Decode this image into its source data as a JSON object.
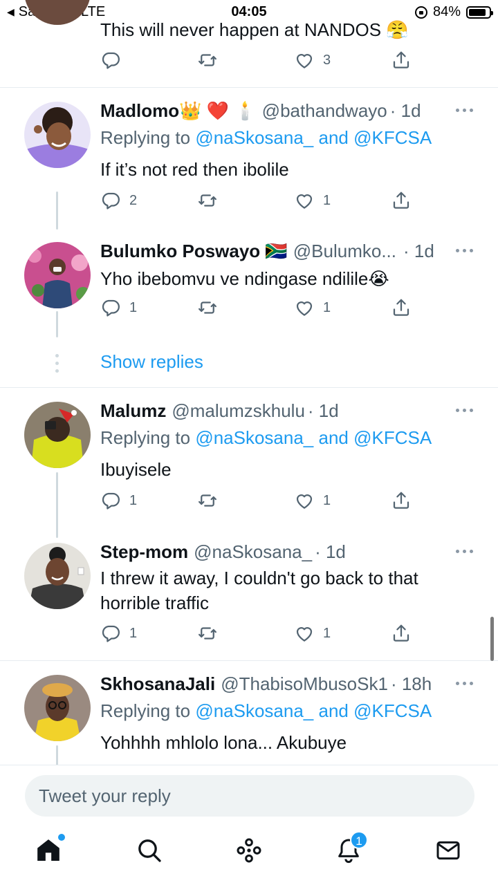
{
  "status_bar": {
    "back_app": "Safari",
    "network": "LTE",
    "time": "04:05",
    "battery": "84%",
    "battery_level": 0.84
  },
  "tweets": [
    {
      "body": "This will never happen at NANDOS 😤",
      "actions": {
        "replies": "",
        "retweets": "",
        "likes": "3"
      }
    },
    {
      "name": "Madlomo👑 ❤️ 🕯️",
      "handle": "@bathandwayo",
      "time": "· 1d",
      "replying_prefix": "Replying to",
      "replying_to": "@naSkosana_ and @KFCSA",
      "body": "If it’s not red then ibolile",
      "actions": {
        "replies": "2",
        "retweets": "",
        "likes": "1"
      }
    },
    {
      "name": "Bulumko Poswayo 🇿🇦",
      "handle": "@Bulumko...",
      "time": "· 1d",
      "body": "Yho ibebomvu ve ndingase ndilile😭",
      "actions": {
        "replies": "1",
        "retweets": "",
        "likes": "1"
      }
    },
    {
      "name": "Malumz",
      "handle": "@malumzskhulu",
      "time": "· 1d",
      "replying_prefix": "Replying to",
      "replying_to": "@naSkosana_ and @KFCSA",
      "body": "Ibuyisele",
      "actions": {
        "replies": "1",
        "retweets": "",
        "likes": "1"
      }
    },
    {
      "name": "Step-mom",
      "handle": "@naSkosana_",
      "time": "· 1d",
      "body": "I threw it away, I couldn't go back to that horrible traffic",
      "actions": {
        "replies": "1",
        "retweets": "",
        "likes": "1"
      }
    },
    {
      "name": "SkhosanaJali",
      "handle": "@ThabisoMbusoSk1",
      "time": "· 18h",
      "replying_prefix": "Replying to",
      "replying_to": "@naSkosana_ and @KFCSA",
      "body": "Yohhhh mhlolo lona... Akubuye"
    }
  ],
  "show_replies": "Show replies",
  "composer": {
    "placeholder": "Tweet your reply"
  },
  "tabbar": {
    "tabs": [
      "home",
      "search",
      "spaces",
      "notifications",
      "messages"
    ],
    "notifications_count": "1"
  },
  "colors": {
    "accent": "#1d9bf0",
    "text": "#0f1419",
    "secondary": "#536471",
    "divider": "#e6ecf0"
  },
  "icons": [
    "reply-icon",
    "retweet-icon",
    "like-icon",
    "share-icon",
    "more-icon",
    "home-icon",
    "search-icon",
    "spaces-icon",
    "bell-icon",
    "mail-icon"
  ]
}
